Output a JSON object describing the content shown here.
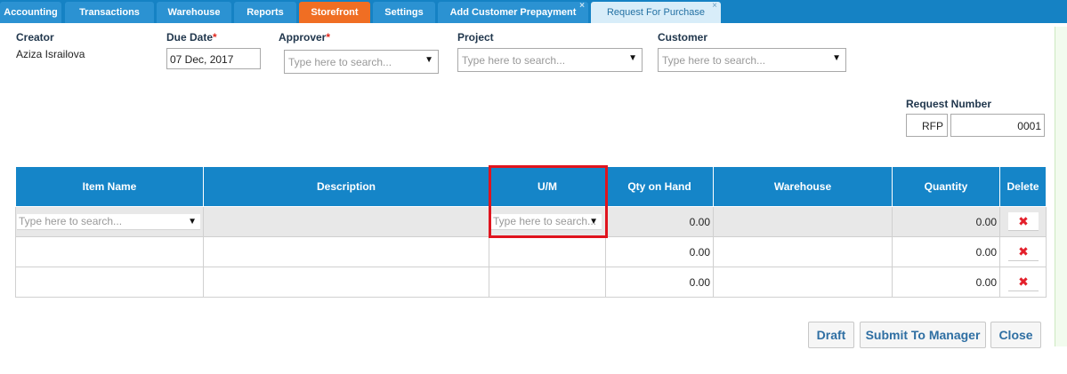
{
  "tabs": [
    {
      "label": "Accounting"
    },
    {
      "label": "Transactions"
    },
    {
      "label": "Warehouse"
    },
    {
      "label": "Reports"
    },
    {
      "label": "Storefront"
    },
    {
      "label": "Settings"
    },
    {
      "label": "Add Customer Prepayment"
    },
    {
      "label": "Request For Purchase"
    }
  ],
  "tab_close_glyph": "×",
  "form": {
    "creator_label": "Creator",
    "creator_value": "Aziza Israilova",
    "due_date_label": "Due Date",
    "due_date_value": "07 Dec, 2017",
    "approver_label": "Approver",
    "approver_placeholder": "Type here to search...",
    "project_label": "Project",
    "project_placeholder": "Type here to search...",
    "customer_label": "Customer",
    "customer_placeholder": "Type here to search...",
    "required_mark": "*",
    "request_number_label": "Request Number",
    "request_prefix": "RFP",
    "request_number": "0001"
  },
  "grid": {
    "headers": [
      "Item Name",
      "Description",
      "U/M",
      "Qty on Hand",
      "Warehouse",
      "Quantity",
      "Delete"
    ],
    "item_placeholder": "Type here to search...",
    "um_placeholder": "Type here to search...",
    "rows": [
      {
        "qty_on_hand": "0.00",
        "quantity": "0.00"
      },
      {
        "qty_on_hand": "0.00",
        "quantity": "0.00"
      },
      {
        "qty_on_hand": "0.00",
        "quantity": "0.00"
      }
    ],
    "delete_glyph": "✖"
  },
  "buttons": {
    "draft": "Draft",
    "submit": "Submit To Manager",
    "close": "Close"
  },
  "colors": {
    "tab_bar": "#1582c4",
    "storefront_tab": "#f06e23",
    "grid_header": "#1585c8",
    "highlight": "#e0141e",
    "delete_icon": "#e3202b"
  },
  "icons": {
    "dropdown": "caret-down-icon",
    "delete": "red-x-icon",
    "tab_close": "close-icon"
  }
}
